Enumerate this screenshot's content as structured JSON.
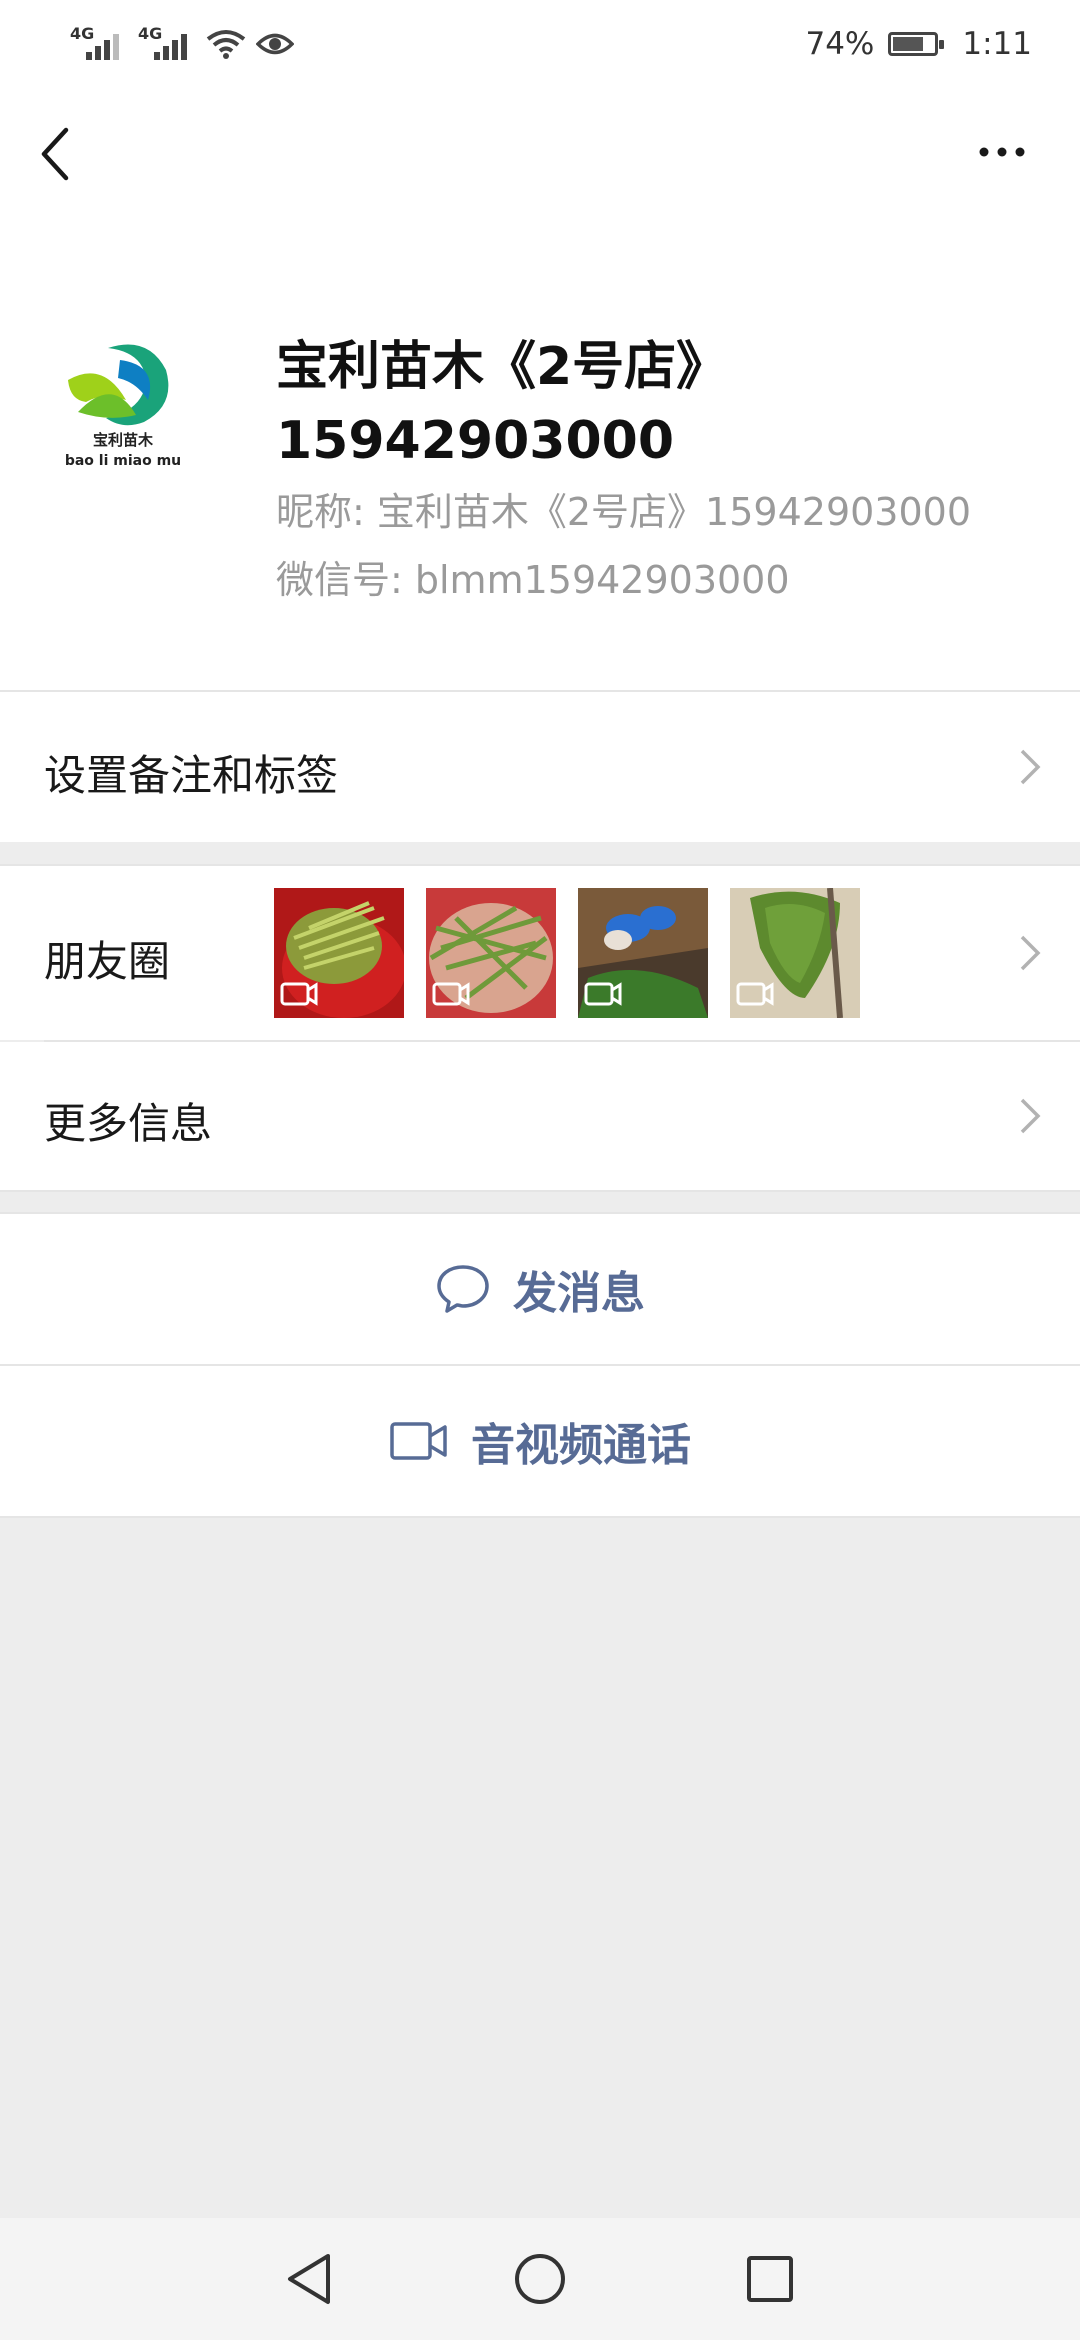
{
  "status_bar": {
    "signal_1": "4G",
    "signal_2": "4G",
    "battery_percent": "74%",
    "battery_level": 0.74,
    "time": "1:11"
  },
  "profile": {
    "name_line1": "宝利苗木《2号店》",
    "name_line2": "15942903000",
    "nickname": "昵称: 宝利苗木《2号店》15942903000",
    "wechat_id": "微信号: blmm15942903000",
    "avatar": {
      "brand_cn": "宝利苗木",
      "brand_pinyin": "bao li miao mu"
    }
  },
  "menu": {
    "remarks_tags": "设置备注和标签",
    "moments": "朋友圈",
    "more_info": "更多信息"
  },
  "actions": {
    "send_message": "发消息",
    "video_call": "音视频通话"
  },
  "colors": {
    "link_blue": "#576b95",
    "background": "#ededed",
    "text_secondary": "#9a9a9a"
  },
  "icons": [
    "back-arrow-icon",
    "more-dots-icon",
    "chat-bubble-icon",
    "video-camera-icon",
    "chevron-right-icon"
  ]
}
